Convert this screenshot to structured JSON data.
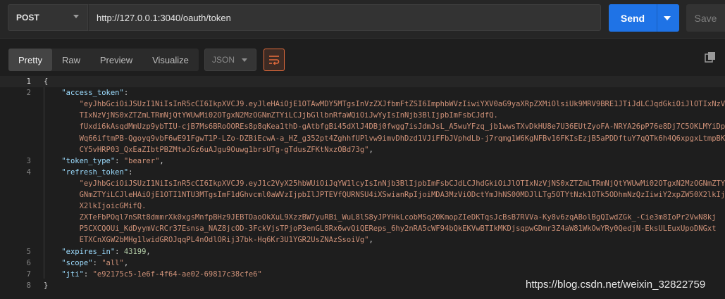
{
  "request": {
    "method": "POST",
    "url": "http://127.0.0.1:3040/oauth/token",
    "send_label": "Send",
    "save_label": "Save"
  },
  "response_tabs": {
    "items": [
      "Pretty",
      "Raw",
      "Preview",
      "Visualize"
    ],
    "active": "Pretty",
    "format": "JSON"
  },
  "editor": {
    "lines": [
      {
        "n": "1",
        "parts": [
          {
            "t": "{",
            "c": "p"
          }
        ]
      },
      {
        "n": "2",
        "parts": [
          {
            "t": "    ",
            "c": "p"
          },
          {
            "t": "\"access_token\"",
            "c": "k"
          },
          {
            "t": ": ",
            "c": "p"
          }
        ]
      },
      {
        "n": "",
        "parts": [
          {
            "t": "        \"eyJhbGciOiJSUzI1NiIsInR5cCI6IkpXVCJ9.eyJleHAiOjE1OTAwMDY5MTgsInVzZXJfbmFtZSI6ImphbWVzIiwiYXV0aG9yaXRpZXMiOlsiUk9MRV9BRE1JTiJdLCJqdGkiOiJlOTIxNzVjNS0xZTZmLTRmNjQtYWUwMi02OTgxN2MzOGNmZTYiLCJjbGllbnRfaWQiOiJwYyIsInNjb3BlIjpbImFsbCJdfQ.",
            "c": "s"
          }
        ]
      },
      {
        "n": "",
        "parts": [
          {
            "t": "        TIxNzVjNS0xZTZmLTRmNjQtYWUwMi02OTgxN2MzOGNmZTYiLCJjbGllbnRfaWQiOiJwYyIsInNjb3BlIjpbImFsbCJdfQ.",
            "c": "s"
          }
        ]
      },
      {
        "n": "",
        "parts": [
          {
            "t": "        fUxdi6kAsqdMmUzp9ybTIU-cjB7Ms6BRoOOREs8p8qKea1thD-gAtbfgBi45dXlJ4DBj0fwgg7isJdmJsL_A5wuYFzq_jb1wwsTXvDkHU8e7U36EUtZyoFA-NRYA26pP76e8Dj7C5OKLMYiDpPjsLFpYpyLvK6b8vsL6Xyp4Ey5Gf",
            "c": "s"
          }
        ]
      },
      {
        "n": "",
        "parts": [
          {
            "t": "        Wq66iftmPB-Qgoyq9vbF6wE91FgwT1P-LZo-DZBiEcwA-a_HZ_g352pt4ZghhfUPlvw9imvDhDzd1VJiFFbJVphdLb-j7rqmg1W6KgNFBv16FKIsEzjB5aPDDftuY7qQTk6h4Q6xpgxLtmpBK1dTHp",
            "c": "s"
          }
        ]
      },
      {
        "n": "",
        "parts": [
          {
            "t": "        CY5vHRP03_QxEaZIbtPBZMtwJGz6uAJgu9Ouwg1brsUTg-gTdusZFKtNxzOBd73g\"",
            "c": "s"
          },
          {
            "t": ",",
            "c": "p"
          }
        ]
      },
      {
        "n": "3",
        "parts": [
          {
            "t": "    ",
            "c": "p"
          },
          {
            "t": "\"token_type\"",
            "c": "k"
          },
          {
            "t": ": ",
            "c": "p"
          },
          {
            "t": "\"bearer\"",
            "c": "s"
          },
          {
            "t": ",",
            "c": "p"
          }
        ]
      },
      {
        "n": "4",
        "parts": [
          {
            "t": "    ",
            "c": "p"
          },
          {
            "t": "\"refresh_token\"",
            "c": "k"
          },
          {
            "t": ": ",
            "c": "p"
          }
        ]
      },
      {
        "n": "",
        "parts": [
          {
            "t": "        \"eyJhbGciOiJSUzI1NiIsInR5cCI6IkpXVCJ9.eyJ1c2VyX25hbWUiOiJqYW1lcyIsInNjb3BlIjpbImFsbCJdLCJhdGkiOiJlOTIxNzVjNS0xZTZmLTRmNjQtYWUwMi02OTgxN2MzOGNmZTYiLCJleHAiOjE2MTAw",
            "c": "s"
          }
        ]
      },
      {
        "n": "",
        "parts": [
          {
            "t": "        GNmZTYiLCJleHAiOjE1OTI1NTU3MTgsImF1dGhvcml0aWVzIjpbIlJPTEVfQURNSU4iXSwianRpIjoiMDA3MzViODctYmJhNS00MDJlLTg5OTYtNzk1OTk5ODhmNzQzIiwiY2xpZW50X2lkIjoicGMifQ.",
            "c": "s"
          }
        ]
      },
      {
        "n": "",
        "parts": [
          {
            "t": "        X2lkIjoicGMifQ.",
            "c": "s"
          }
        ]
      },
      {
        "n": "",
        "parts": [
          {
            "t": "        ZXTeFbPOql7nSRt8dmmrXk0xgsMnfpBHz9JEBTOaoOkXuL9XzzBW7yuRBi_WuL8lS8yJPYHkLcobMSq20KmopZIeDKTqsJcBsB7RVVa-Ky8v6zqABolBgQIwdZGk_-Cie3m8IoPr2VwN8kj",
            "c": "s"
          }
        ]
      },
      {
        "n": "",
        "parts": [
          {
            "t": "        P5CXCQOUi_KdDyymVcRCr37Esnsa_NAZ8jcOD-3FckVjsTPjoP3enGL8Rx6wvQiQEReps_6hy2nRA5cWF94bQkEKVwBTIkMKDjsqpwGDmr3Z4aW81WkOwYRy0QedjN-EksULEuxUpoDNGxt",
            "c": "s"
          }
        ]
      },
      {
        "n": "",
        "parts": [
          {
            "t": "        ETXCnXGW2bMHg1lwidGROJqqPL4nOdlORij37bk-Hq6Kr3U1YGR2UsZNAzSsoiVg\"",
            "c": "s"
          },
          {
            "t": ",",
            "c": "p"
          }
        ]
      },
      {
        "n": "5",
        "parts": [
          {
            "t": "    ",
            "c": "p"
          },
          {
            "t": "\"expires_in\"",
            "c": "k"
          },
          {
            "t": ": ",
            "c": "p"
          },
          {
            "t": "43199",
            "c": "n"
          },
          {
            "t": ",",
            "c": "p"
          }
        ]
      },
      {
        "n": "6",
        "parts": [
          {
            "t": "    ",
            "c": "p"
          },
          {
            "t": "\"scope\"",
            "c": "k"
          },
          {
            "t": ": ",
            "c": "p"
          },
          {
            "t": "\"all\"",
            "c": "s"
          },
          {
            "t": ",",
            "c": "p"
          }
        ]
      },
      {
        "n": "7",
        "parts": [
          {
            "t": "    ",
            "c": "p"
          },
          {
            "t": "\"jti\"",
            "c": "k"
          },
          {
            "t": ": ",
            "c": "p"
          },
          {
            "t": "\"e92175c5-1e6f-4f64-ae02-69817c38cfe6\"",
            "c": "s"
          }
        ]
      },
      {
        "n": "8",
        "parts": [
          {
            "t": "}",
            "c": "p"
          }
        ]
      }
    ]
  },
  "watermark": "https://blog.csdn.net/weixin_32822759",
  "colors": {
    "send": "#1f73e6",
    "accent": "#e26b3c",
    "key": "#9cdcfe",
    "string": "#ce9178",
    "number": "#b5cea8"
  },
  "icons": {
    "wrap": "wrap-lines-icon",
    "copy": "copy-icon"
  }
}
